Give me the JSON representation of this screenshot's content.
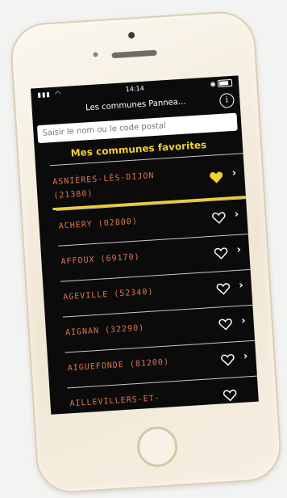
{
  "status_bar": {
    "time": "14:14"
  },
  "nav": {
    "title": "Les communes Pannea…",
    "info_icon": "info-icon",
    "info_glyph": "i"
  },
  "search": {
    "placeholder": "Saisir le nom ou le code postal"
  },
  "favorites": {
    "header": "Mes communes favorites",
    "accent_color": "#f2cf2c",
    "name_color": "#e07650"
  },
  "communes": [
    {
      "name": "ASNIÈRES-LÈS-DIJON\n(21380)",
      "favorite": true
    },
    {
      "name": "ACHERY (02800)",
      "favorite": false
    },
    {
      "name": "AFFOUX (69170)",
      "favorite": false
    },
    {
      "name": "AGEVILLE (52340)",
      "favorite": false
    },
    {
      "name": "AIGNAN (32290)",
      "favorite": false
    },
    {
      "name": "AIGUEFONDE (81200)",
      "favorite": false
    },
    {
      "name": "AILLEVILLERS-ET-",
      "favorite": false
    }
  ],
  "chevron": "›"
}
